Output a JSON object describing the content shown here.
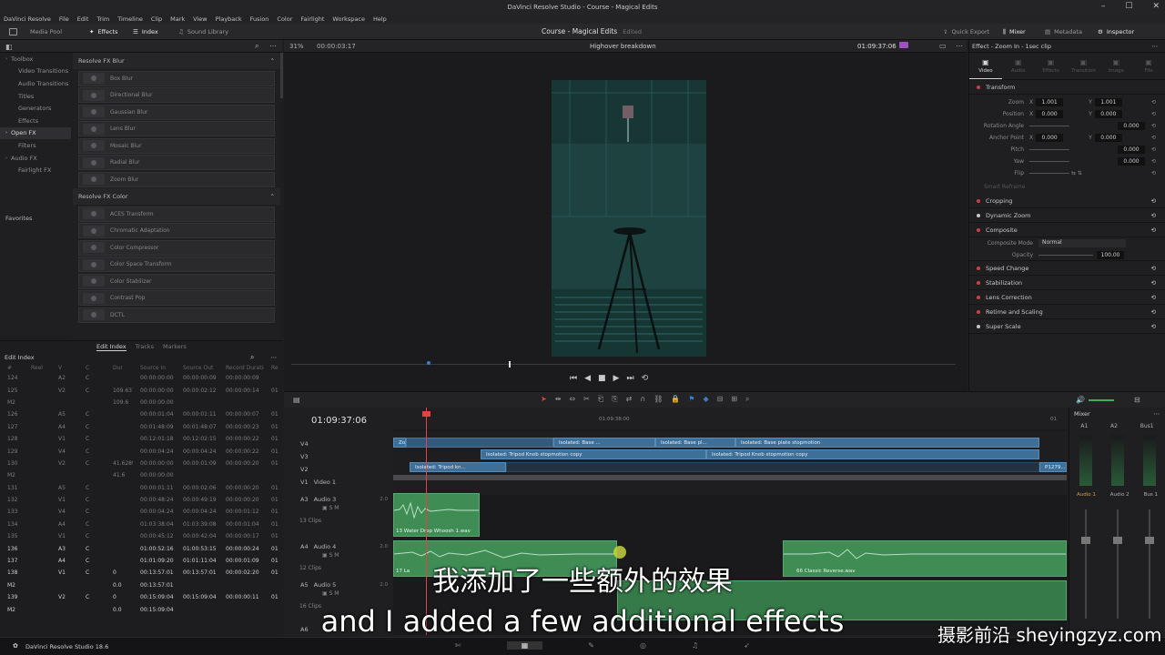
{
  "window": {
    "title": "DaVinci Resolve Studio - Course - Magical Edits"
  },
  "menu": [
    "DaVinci Resolve",
    "File",
    "Edit",
    "Trim",
    "Timeline",
    "Clip",
    "Mark",
    "View",
    "Playback",
    "Fusion",
    "Color",
    "Fairlight",
    "Workspace",
    "Help"
  ],
  "toolbar": {
    "media_pool": "Media Pool",
    "effects": "Effects",
    "index": "Index",
    "sound_library": "Sound Library",
    "project_title": "Course - Magical Edits",
    "project_state": "Edited",
    "quick_export": "Quick Export",
    "mixer": "Mixer",
    "metadata": "Metadata",
    "inspector": "Inspector"
  },
  "effects_panel": {
    "tree": [
      {
        "label": "Toolbox",
        "sub": false,
        "sel": false
      },
      {
        "label": "Video Transitions",
        "sub": true,
        "sel": false
      },
      {
        "label": "Audio Transitions",
        "sub": true,
        "sel": false
      },
      {
        "label": "Titles",
        "sub": true,
        "sel": false
      },
      {
        "label": "Generators",
        "sub": true,
        "sel": false
      },
      {
        "label": "Effects",
        "sub": true,
        "sel": false
      },
      {
        "label": "Open FX",
        "sub": false,
        "sel": true
      },
      {
        "label": "Filters",
        "sub": true,
        "sel": false
      },
      {
        "label": "Audio FX",
        "sub": false,
        "sel": false
      },
      {
        "label": "Fairlight FX",
        "sub": true,
        "sel": false
      }
    ],
    "favorites": "Favorites",
    "sections": [
      {
        "title": "Resolve FX Blur",
        "items": [
          "Box Blur",
          "Directional Blur",
          "Gaussian Blur",
          "Lens Blur",
          "Mosaic Blur",
          "Radial Blur",
          "Zoom Blur"
        ]
      },
      {
        "title": "Resolve FX Color",
        "items": [
          "ACES Transform",
          "Chromatic Adaptation",
          "Color Compressor",
          "Color Space Transform",
          "Color Stabilizer",
          "Contrast Pop",
          "DCTL"
        ]
      }
    ]
  },
  "edit_index": {
    "tabs": [
      "Edit Index",
      "Tracks",
      "Markers"
    ],
    "title": "Edit Index",
    "columns": [
      "#",
      "Reel",
      "V",
      "C",
      "Dur",
      "Source In",
      "Source Out",
      "Record Duratio",
      "Re"
    ],
    "rows": [
      {
        "hl": false,
        "c": [
          "124",
          "",
          "A2",
          "C",
          "",
          "00:00:00:00",
          "00:00:00:09",
          "00:00:00:09",
          ""
        ]
      },
      {
        "hl": false,
        "c": [
          "125",
          "",
          "V2",
          "C",
          "109.637",
          "00:00:00:00",
          "00:00:02:12",
          "00:00:00:14",
          "01"
        ]
      },
      {
        "hl": false,
        "c": [
          "M2",
          "",
          "",
          "",
          "109.6",
          "00:00:00:00",
          "",
          "",
          ""
        ]
      },
      {
        "hl": false,
        "c": [
          "126",
          "",
          "A5",
          "C",
          "",
          "00:00:01:04",
          "00:00:01:11",
          "00:00:00:07",
          "01"
        ]
      },
      {
        "hl": false,
        "c": [
          "127",
          "",
          "A4",
          "C",
          "",
          "00:01:48:09",
          "00:01:48:07",
          "00:00:00:23",
          "01"
        ]
      },
      {
        "hl": false,
        "c": [
          "128",
          "",
          "V1",
          "C",
          "",
          "00:12:01:18",
          "00:12:02:15",
          "00:00:00:22",
          "01"
        ]
      },
      {
        "hl": false,
        "c": [
          "129",
          "",
          "V4",
          "C",
          "",
          "00:00:04:24",
          "00:00:04:24",
          "00:00:00:22",
          "01"
        ]
      },
      {
        "hl": false,
        "c": [
          "130",
          "",
          "V2",
          "C",
          "41.6289",
          "00:00:00:00",
          "00:00:01:09",
          "00:00:00:20",
          "01"
        ]
      },
      {
        "hl": false,
        "c": [
          "M2",
          "",
          "",
          "",
          "41.6",
          "00:00:00:00",
          "",
          "",
          ""
        ]
      },
      {
        "hl": false,
        "c": [
          "131",
          "",
          "A5",
          "C",
          "",
          "00:00:01:11",
          "00:00:02:06",
          "00:00:00:20",
          "01"
        ]
      },
      {
        "hl": false,
        "c": [
          "132",
          "",
          "V1",
          "C",
          "",
          "00:00:48:24",
          "00:00:49:19",
          "00:00:00:20",
          "01"
        ]
      },
      {
        "hl": false,
        "c": [
          "133",
          "",
          "V4",
          "C",
          "",
          "00:00:04:24",
          "00:00:04:24",
          "00:00:01:12",
          "01"
        ]
      },
      {
        "hl": false,
        "c": [
          "134",
          "",
          "A4",
          "C",
          "",
          "01:03:38:04",
          "01:03:39:08",
          "00:00:01:04",
          "01"
        ]
      },
      {
        "hl": false,
        "c": [
          "135",
          "",
          "V1",
          "C",
          "",
          "00:00:45:12",
          "00:00:42:04",
          "00:00:00:17",
          "01"
        ]
      },
      {
        "hl": true,
        "c": [
          "136",
          "",
          "A3",
          "C",
          "",
          "01:00:52:16",
          "01:00:53:15",
          "00:00:00:24",
          "01"
        ]
      },
      {
        "hl": true,
        "c": [
          "137",
          "",
          "A4",
          "C",
          "",
          "01:01:09:20",
          "01:01:11:04",
          "00:00:01:09",
          "01"
        ]
      },
      {
        "hl": true,
        "c": [
          "138",
          "",
          "V1",
          "C",
          "0",
          "00:13:57:01",
          "00:13:57:01",
          "00:00:02:20",
          "01"
        ]
      },
      {
        "hl": true,
        "c": [
          "M2",
          "",
          "",
          "",
          "0.0",
          "00:13:57:01",
          "",
          "",
          ""
        ]
      },
      {
        "hl": true,
        "c": [
          "139",
          "",
          "V2",
          "C",
          "0",
          "00:15:09:04",
          "00:15:09:04",
          "00:00:00:11",
          "01"
        ]
      },
      {
        "hl": true,
        "c": [
          "M2",
          "",
          "",
          "",
          "0.0",
          "00:15:09:04",
          "",
          "",
          ""
        ]
      }
    ]
  },
  "viewer": {
    "zoom": "31%",
    "timecode_left": "00:00:03:17",
    "clip_name": "Highover breakdown",
    "timecode_right": "01:09:37:06"
  },
  "inspector": {
    "clip_title": "Effect - Zoom In - 1sec clip",
    "tabs": [
      "Video",
      "Audio",
      "Effects",
      "Transition",
      "Image",
      "File"
    ],
    "transform": "Transform",
    "params": [
      {
        "label": "Zoom",
        "x": "1.001",
        "y": "1.001"
      },
      {
        "label": "Position",
        "x": "0.000",
        "y": "0.000"
      },
      {
        "label": "Rotation Angle",
        "x": "",
        "y": "0.000"
      },
      {
        "label": "Anchor Point",
        "x": "0.000",
        "y": "0.000"
      },
      {
        "label": "Pitch",
        "x": "",
        "y": "0.000"
      },
      {
        "label": "Yaw",
        "x": "",
        "y": "0.000"
      },
      {
        "label": "Flip",
        "x": "",
        "y": ""
      }
    ],
    "smart_reframe": "Smart Reframe",
    "sections": [
      "Cropping",
      "Dynamic Zoom",
      "Composite"
    ],
    "composite_mode_label": "Composite Mode",
    "composite_mode": "Normal",
    "opacity_label": "Opacity",
    "opacity": "100.00",
    "sections2": [
      "Speed Change",
      "Stabilization",
      "Lens Correction",
      "Retime and Scaling",
      "Super Scale"
    ]
  },
  "timeline": {
    "timecode": "01:09:37:06",
    "ruler": [
      "01:09:38:00",
      "01"
    ],
    "tracks": [
      {
        "id": "V4",
        "name": ""
      },
      {
        "id": "V3",
        "name": ""
      },
      {
        "id": "V2",
        "name": ""
      },
      {
        "id": "V1",
        "name": "Video 1"
      },
      {
        "id": "A3",
        "name": "Audio 3",
        "vol": "2.0",
        "clips": "13 Clips"
      },
      {
        "id": "A4",
        "name": "Audio 4",
        "vol": "2.0",
        "clips": "12 Clips"
      },
      {
        "id": "A5",
        "name": "Audio 5",
        "vol": "2.0",
        "clips": "16 Clips"
      },
      {
        "id": "A6",
        "name": "",
        "vol": "",
        "clips": ""
      }
    ],
    "clips": {
      "v4a": "Zo...",
      "v4b": "Isolated: Base ...",
      "v4c": "Isolated: Base pl...",
      "v4d": "Isolated: Base plate stopmotion",
      "v3a": "Isolated: Tripod Knob stopmotion copy",
      "v3b": "Isolated: Tripod Knob stopmotion copy",
      "v2a": "Isolated: Tripod kn...",
      "v2b": "P1279...",
      "a3": "13 Water Drop Whoosh 1.wav",
      "a4": "17 La",
      "a4b": "66 Classic Reverse.wav"
    }
  },
  "mixer": {
    "title": "Mixer",
    "channels": [
      "A1",
      "A2",
      "Bus1"
    ],
    "channels2": [
      "Audio 1",
      "Audio 2",
      "Bus 1"
    ]
  },
  "bottom": {
    "app": "DaVinci Resolve Studio 18.6"
  },
  "subtitles": {
    "cn": "我添加了一些额外的效果",
    "en": "and I added a few additional effects"
  },
  "watermark": "摄影前沿 sheyingzyz.com",
  "colors": {
    "accent": "#d04040",
    "video_clip": "#3d6f99",
    "audio_clip": "#3f8d55",
    "playhead": "#e04444"
  }
}
